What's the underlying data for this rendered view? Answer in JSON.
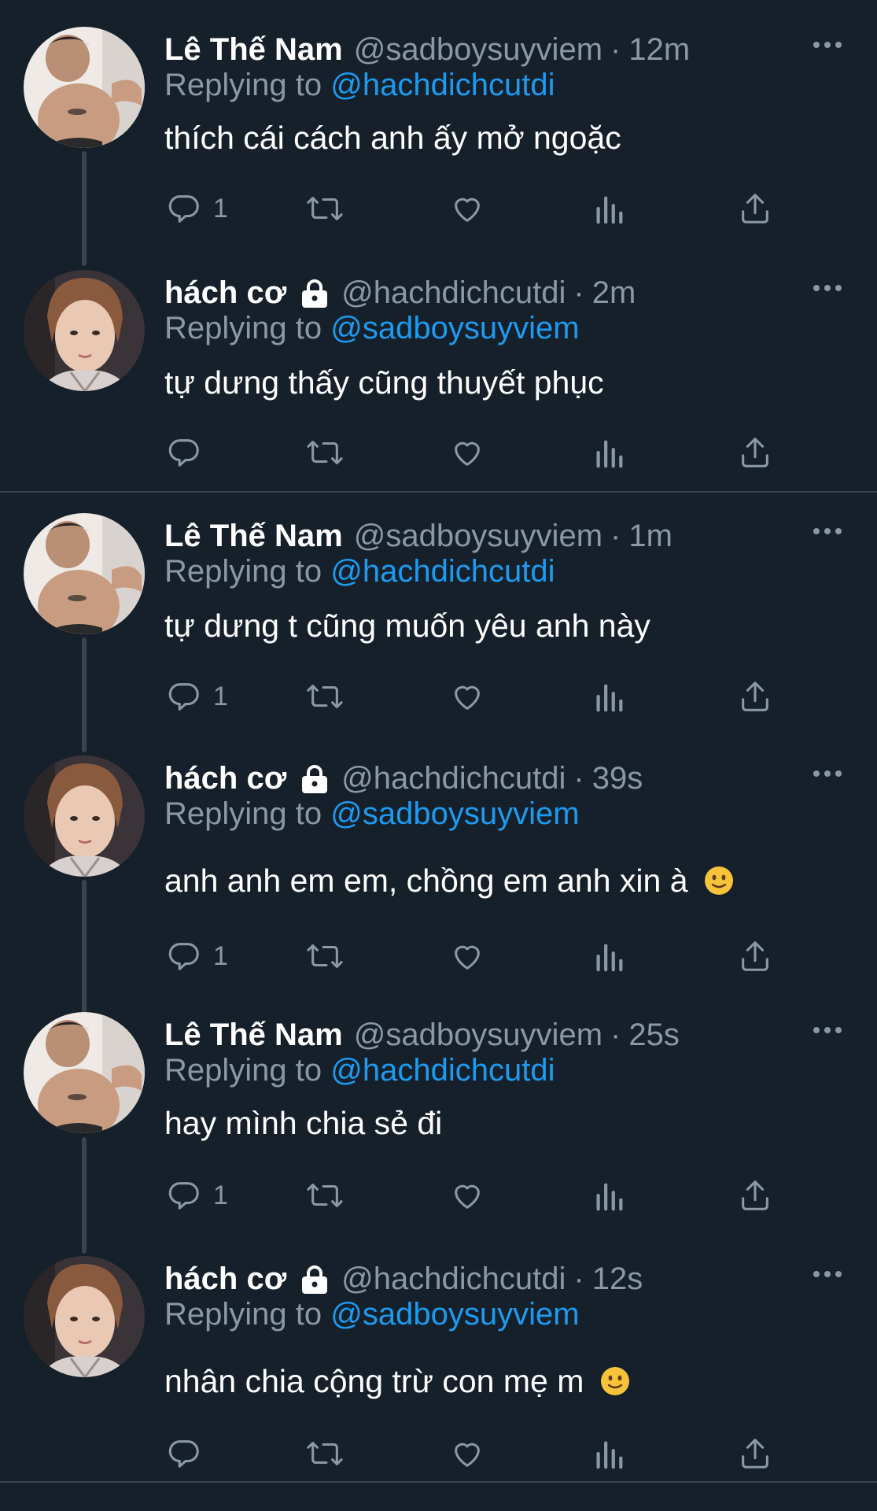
{
  "colors": {
    "background": "#15202b",
    "text": "#ffffff",
    "muted": "#8b98a5",
    "link": "#1d9bf0",
    "divider": "#38444d"
  },
  "reply_prefix": "Replying to",
  "tweets": [
    {
      "name": "Lê Thế Nam",
      "handle": "@sadboysuyviem",
      "separator": "·",
      "time": "12m",
      "reply_to": "@hachdichcutdi",
      "text": "thích cái cách anh ấy mở ngoặc",
      "reply_count": "1",
      "protected": false,
      "avatar": "lethenam-avatar",
      "emoji": ""
    },
    {
      "name": "hách cơ",
      "handle": "@hachdichcutdi",
      "separator": "·",
      "time": "2m",
      "reply_to": "@sadboysuyviem",
      "text": "tự dưng thấy cũng thuyết phục",
      "reply_count": "",
      "protected": true,
      "avatar": "hachco-avatar",
      "emoji": ""
    },
    {
      "name": "Lê Thế Nam",
      "handle": "@sadboysuyviem",
      "separator": "·",
      "time": "1m",
      "reply_to": "@hachdichcutdi",
      "text": "tự dưng t cũng muốn yêu anh này",
      "reply_count": "1",
      "protected": false,
      "avatar": "lethenam-avatar",
      "emoji": ""
    },
    {
      "name": "hách cơ",
      "handle": "@hachdichcutdi",
      "separator": "·",
      "time": "39s",
      "reply_to": "@sadboysuyviem",
      "text": "anh anh em em, chồng em anh xin à",
      "reply_count": "1",
      "protected": true,
      "avatar": "hachco-avatar",
      "emoji": "slightly-smiling-face"
    },
    {
      "name": "Lê Thế Nam",
      "handle": "@sadboysuyviem",
      "separator": "·",
      "time": "25s",
      "reply_to": "@hachdichcutdi",
      "text": "hay mình chia sẻ đi",
      "reply_count": "1",
      "protected": false,
      "avatar": "lethenam-avatar",
      "emoji": ""
    },
    {
      "name": "hách cơ",
      "handle": "@hachdichcutdi",
      "separator": "·",
      "time": "12s",
      "reply_to": "@sadboysuyviem",
      "text": "nhân chia cộng trừ con mẹ m",
      "reply_count": "",
      "protected": true,
      "avatar": "hachco-avatar",
      "emoji": "slightly-smiling-face"
    }
  ],
  "icons": {
    "reply": "reply-icon",
    "retweet": "retweet-icon",
    "like": "like-icon",
    "views": "views-icon",
    "share": "share-icon",
    "more": "more-icon",
    "lock": "lock-icon"
  }
}
